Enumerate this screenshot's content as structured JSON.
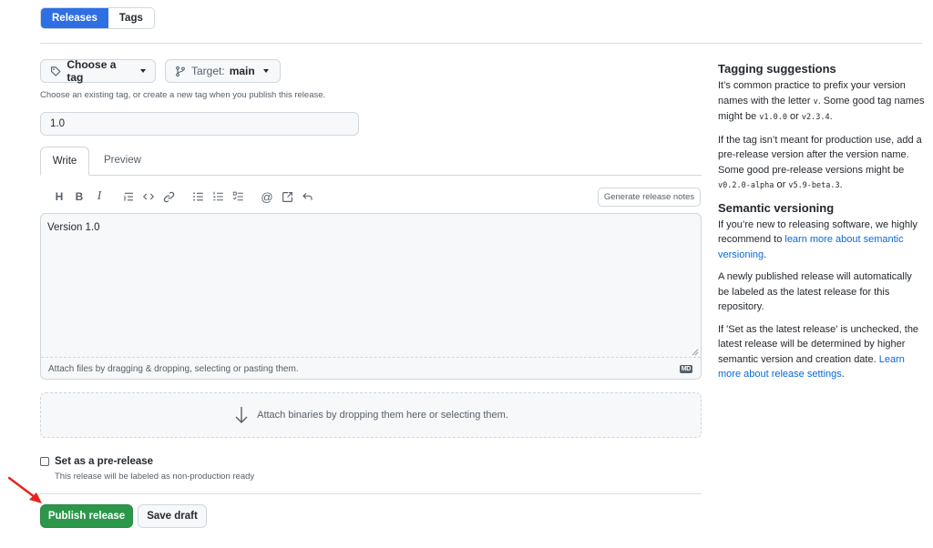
{
  "tabs": {
    "releases": "Releases",
    "tags": "Tags"
  },
  "tag_picker": {
    "label": "Choose a tag",
    "hint": "Choose an existing tag, or create a new tag when you publish this release."
  },
  "target": {
    "prefix": "Target:",
    "branch": "main"
  },
  "version_field": {
    "value": "1.0"
  },
  "editor": {
    "tab_write": "Write",
    "tab_preview": "Preview",
    "generate_notes": "Generate release notes",
    "body": "Version 1.0",
    "attach_hint": "Attach files by dragging & dropping, selecting or pasting them.",
    "md_badge": "MD",
    "toolbar": [
      "heading-icon",
      "bold-icon",
      "italic-icon",
      "quote-icon",
      "code-icon",
      "link-icon",
      "bulleted-list-icon",
      "numbered-list-icon",
      "task-list-icon",
      "mention-icon",
      "cross-reference-icon",
      "reply-icon"
    ]
  },
  "binaries": {
    "label": "Attach binaries by dropping them here or selecting them."
  },
  "prerelease": {
    "label": "Set as a pre-release",
    "sub": "This release will be labeled as non-production ready",
    "checked": false
  },
  "actions": {
    "publish": "Publish release",
    "draft": "Save draft"
  },
  "sidebar": {
    "tagging_title": "Tagging suggestions",
    "tagging_p1_a": "It’s common practice to prefix your version names with the letter ",
    "tagging_p1_v": "v",
    "tagging_p1_b": ". Some good tag names might be ",
    "tagging_p1_code1": "v1.0.0",
    "tagging_p1_or": " or ",
    "tagging_p1_code2": "v2.3.4",
    "tagging_p1_end": ".",
    "tagging_p2_a": "If the tag isn’t meant for production use, add a pre-release version after the version name. Some good pre-release versions might be ",
    "tagging_p2_code1": "v0.2.0-alpha",
    "tagging_p2_or": " or ",
    "tagging_p2_code2": "v5.9-beta.3",
    "tagging_p2_end": ".",
    "semver_title": "Semantic versioning",
    "semver_p1_a": "If you’re new to releasing software, we highly recommend to ",
    "semver_p1_link": "learn more about semantic versioning",
    "semver_p1_end": ".",
    "semver_p2": "A newly published release will automatically be labeled as the latest release for this repository.",
    "semver_p3_a": "If 'Set as the latest release' is unchecked, the latest release will be determined by higher semantic version and creation date. ",
    "semver_p3_link": "Learn more about release settings",
    "semver_p3_end": "."
  },
  "colors": {
    "accent": "#2f6fe4",
    "publish": "#2c974b",
    "link": "#0969da",
    "arrow": "#e8231b"
  }
}
